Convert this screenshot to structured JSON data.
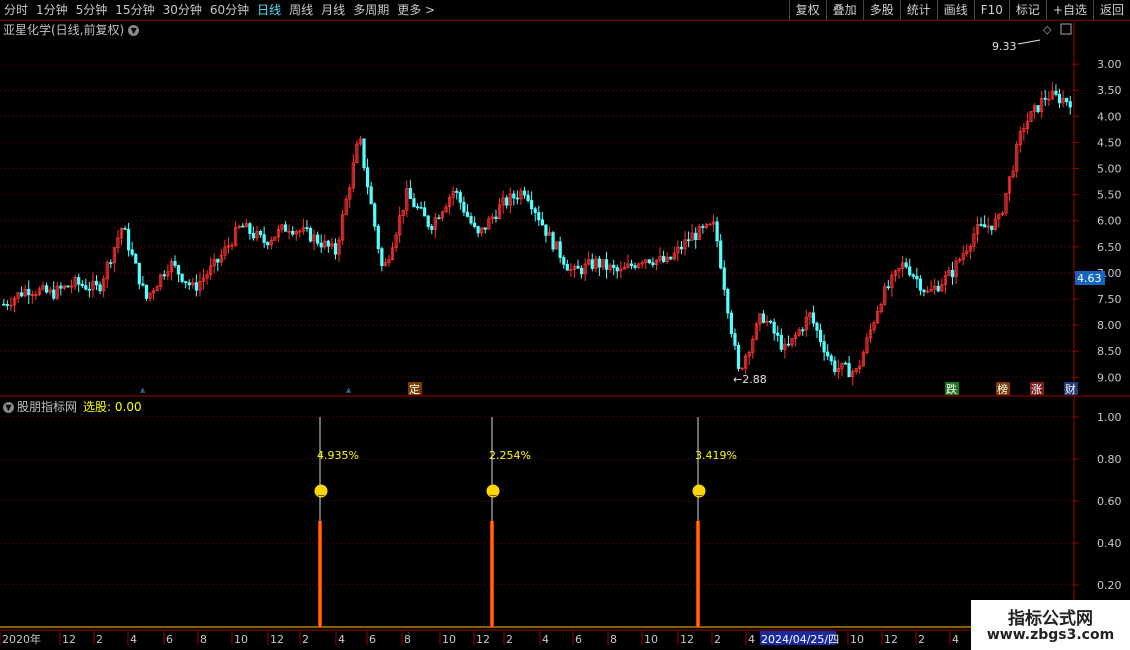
{
  "toolbar": {
    "periods": [
      "分时",
      "1分钟",
      "5分钟",
      "15分钟",
      "30分钟",
      "60分钟",
      "日线",
      "周线",
      "月线",
      "多周期",
      "更多 >"
    ],
    "active_period": "日线",
    "right_buttons": [
      "复权",
      "叠加",
      "多股",
      "统计",
      "画线",
      "F10",
      "标记",
      "+自选",
      "返回"
    ]
  },
  "main_chart": {
    "title": "亚星化学(日线,前复权)",
    "high_label": "9.33",
    "low_label": "2.88",
    "current_price": "4.63",
    "y_ticks": [
      "9.00",
      "8.50",
      "8.00",
      "7.50",
      "7.00",
      "6.50",
      "6.00",
      "5.50",
      "5.00",
      "4.50",
      "4.00",
      "3.50",
      "3.00"
    ],
    "markers": [
      "定",
      "跌",
      "榜",
      "涨",
      "财"
    ],
    "colors": {
      "up": "#ff3232",
      "down": "#54ffff",
      "grid": "#8b0000",
      "current_price_bg": "#1565c0"
    }
  },
  "indicator": {
    "name": "股朋指标网",
    "select_label": "选股: 0.00",
    "signals": [
      {
        "pct": "4.935%",
        "value": 1.0
      },
      {
        "pct": "2.254%",
        "value": 1.0
      },
      {
        "pct": "3.419%",
        "value": 1.0
      }
    ],
    "y_ticks": [
      "1.00",
      "0.80",
      "0.60",
      "0.40",
      "0.20"
    ]
  },
  "time_axis": {
    "labels": [
      "2020年",
      "12",
      "2",
      "4",
      "6",
      "8",
      "10",
      "12",
      "2",
      "4",
      "6",
      "8",
      "10",
      "12",
      "2",
      "4",
      "6",
      "8",
      "10",
      "12",
      "2",
      "4"
    ],
    "highlight_date": "2024/04/25/四",
    "after_labels": [
      "10",
      "12",
      "2",
      "4"
    ]
  },
  "watermark": {
    "line1": "指标公式网",
    "line2": "www.zbgs3.com"
  },
  "chart_data": {
    "type": "candlestick",
    "title": "亚星化学(日线,前复权)",
    "y_range": [
      2.7,
      9.5
    ],
    "y_ticks": [
      3.0,
      3.5,
      4.0,
      4.5,
      5.0,
      5.5,
      6.0,
      6.5,
      7.0,
      7.5,
      8.0,
      8.5,
      9.0
    ],
    "max_label": 9.33,
    "min_label": 2.88,
    "last_price": 4.63,
    "close_path_approx": [
      4.4,
      4.7,
      4.6,
      4.8,
      4.7,
      5.9,
      4.5,
      5.2,
      4.7,
      5.2,
      5.9,
      5.6,
      5.9,
      5.7,
      5.4,
      7.6,
      5.0,
      6.5,
      5.9,
      6.6,
      5.7,
      6.3,
      6.6,
      5.7,
      5.0,
      5.2,
      5.0,
      5.3,
      5.2,
      5.7,
      5.9,
      3.1,
      4.2,
      3.5,
      4.2,
      3.2,
      3.1,
      4.5,
      5.2,
      4.6,
      5.0,
      5.8,
      6.0,
      7.8,
      8.4,
      8.3
    ]
  }
}
